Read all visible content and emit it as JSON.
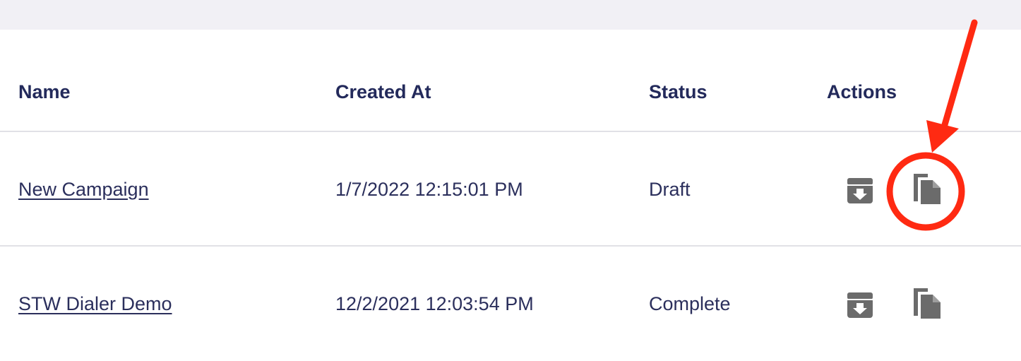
{
  "table": {
    "columns": [
      "Name",
      "Created At",
      "Status",
      "Actions"
    ],
    "rows": [
      {
        "name": "New Campaign",
        "created_at": "1/7/2022 12:15:01 PM",
        "status": "Draft",
        "actions": [
          "archive-icon",
          "copy-icon"
        ]
      },
      {
        "name": "STW Dialer Demo",
        "created_at": "12/2/2021 12:03:54 PM",
        "status": "Complete",
        "actions": [
          "archive-icon",
          "copy-icon"
        ]
      }
    ]
  },
  "colors": {
    "text": "#2b2f5c",
    "header_text": "#232a5b",
    "icon": "#6b6b6b",
    "annotation": "#ff2a12",
    "top_bar": "#f1f0f5",
    "divider": "#e1e1e6"
  }
}
